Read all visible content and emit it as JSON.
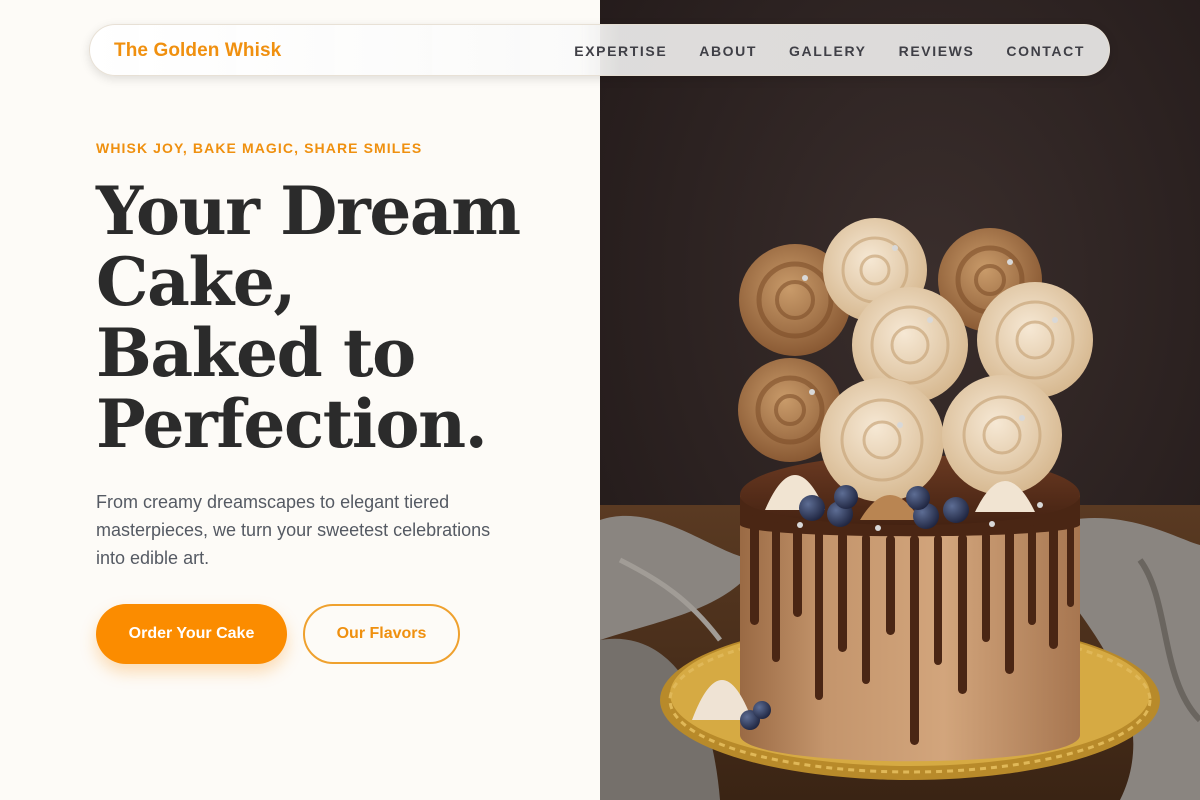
{
  "brand": {
    "name": "The Golden Whisk"
  },
  "nav": {
    "links": [
      {
        "label": "EXPERTISE"
      },
      {
        "label": "ABOUT"
      },
      {
        "label": "GALLERY"
      },
      {
        "label": "REVIEWS"
      },
      {
        "label": "CONTACT"
      }
    ]
  },
  "hero": {
    "eyebrow": "WHISK JOY, BAKE MAGIC, SHARE SMILES",
    "headline_lines": [
      "Your Dream",
      "Cake,",
      "Baked to",
      "Perfection."
    ],
    "subtext": "From creamy dreamscapes to elegant tiered masterpieces, we turn your sweetest celebrations into edible art.",
    "primary_cta": "Order Your Cake",
    "secondary_cta": "Our Flavors"
  },
  "colors": {
    "accent": "#fb8c00",
    "accent_text": "#ef900f",
    "heading": "#2b2b2b",
    "body_text": "#555a63",
    "page_bg": "#fdfbf7",
    "photo_bg": "#2a1f1d"
  },
  "image": {
    "subject": "chocolate drip cake topped with buttercream rosettes, meringue kisses and blueberries"
  }
}
